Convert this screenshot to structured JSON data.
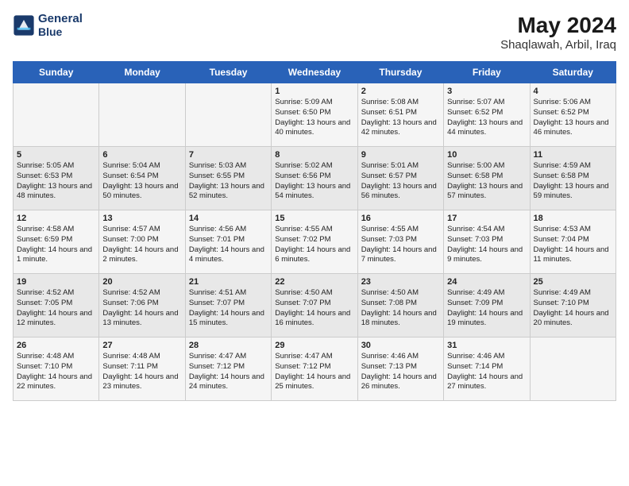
{
  "logo": {
    "line1": "General",
    "line2": "Blue"
  },
  "title": "May 2024",
  "subtitle": "Shaqlawah, Arbil, Iraq",
  "days_of_week": [
    "Sunday",
    "Monday",
    "Tuesday",
    "Wednesday",
    "Thursday",
    "Friday",
    "Saturday"
  ],
  "weeks": [
    [
      {
        "day": "",
        "info": ""
      },
      {
        "day": "",
        "info": ""
      },
      {
        "day": "",
        "info": ""
      },
      {
        "day": "1",
        "info": "Sunrise: 5:09 AM\nSunset: 6:50 PM\nDaylight: 13 hours\nand 40 minutes."
      },
      {
        "day": "2",
        "info": "Sunrise: 5:08 AM\nSunset: 6:51 PM\nDaylight: 13 hours\nand 42 minutes."
      },
      {
        "day": "3",
        "info": "Sunrise: 5:07 AM\nSunset: 6:52 PM\nDaylight: 13 hours\nand 44 minutes."
      },
      {
        "day": "4",
        "info": "Sunrise: 5:06 AM\nSunset: 6:52 PM\nDaylight: 13 hours\nand 46 minutes."
      }
    ],
    [
      {
        "day": "5",
        "info": "Sunrise: 5:05 AM\nSunset: 6:53 PM\nDaylight: 13 hours\nand 48 minutes."
      },
      {
        "day": "6",
        "info": "Sunrise: 5:04 AM\nSunset: 6:54 PM\nDaylight: 13 hours\nand 50 minutes."
      },
      {
        "day": "7",
        "info": "Sunrise: 5:03 AM\nSunset: 6:55 PM\nDaylight: 13 hours\nand 52 minutes."
      },
      {
        "day": "8",
        "info": "Sunrise: 5:02 AM\nSunset: 6:56 PM\nDaylight: 13 hours\nand 54 minutes."
      },
      {
        "day": "9",
        "info": "Sunrise: 5:01 AM\nSunset: 6:57 PM\nDaylight: 13 hours\nand 56 minutes."
      },
      {
        "day": "10",
        "info": "Sunrise: 5:00 AM\nSunset: 6:58 PM\nDaylight: 13 hours\nand 57 minutes."
      },
      {
        "day": "11",
        "info": "Sunrise: 4:59 AM\nSunset: 6:58 PM\nDaylight: 13 hours\nand 59 minutes."
      }
    ],
    [
      {
        "day": "12",
        "info": "Sunrise: 4:58 AM\nSunset: 6:59 PM\nDaylight: 14 hours\nand 1 minute."
      },
      {
        "day": "13",
        "info": "Sunrise: 4:57 AM\nSunset: 7:00 PM\nDaylight: 14 hours\nand 2 minutes."
      },
      {
        "day": "14",
        "info": "Sunrise: 4:56 AM\nSunset: 7:01 PM\nDaylight: 14 hours\nand 4 minutes."
      },
      {
        "day": "15",
        "info": "Sunrise: 4:55 AM\nSunset: 7:02 PM\nDaylight: 14 hours\nand 6 minutes."
      },
      {
        "day": "16",
        "info": "Sunrise: 4:55 AM\nSunset: 7:03 PM\nDaylight: 14 hours\nand 7 minutes."
      },
      {
        "day": "17",
        "info": "Sunrise: 4:54 AM\nSunset: 7:03 PM\nDaylight: 14 hours\nand 9 minutes."
      },
      {
        "day": "18",
        "info": "Sunrise: 4:53 AM\nSunset: 7:04 PM\nDaylight: 14 hours\nand 11 minutes."
      }
    ],
    [
      {
        "day": "19",
        "info": "Sunrise: 4:52 AM\nSunset: 7:05 PM\nDaylight: 14 hours\nand 12 minutes."
      },
      {
        "day": "20",
        "info": "Sunrise: 4:52 AM\nSunset: 7:06 PM\nDaylight: 14 hours\nand 13 minutes."
      },
      {
        "day": "21",
        "info": "Sunrise: 4:51 AM\nSunset: 7:07 PM\nDaylight: 14 hours\nand 15 minutes."
      },
      {
        "day": "22",
        "info": "Sunrise: 4:50 AM\nSunset: 7:07 PM\nDaylight: 14 hours\nand 16 minutes."
      },
      {
        "day": "23",
        "info": "Sunrise: 4:50 AM\nSunset: 7:08 PM\nDaylight: 14 hours\nand 18 minutes."
      },
      {
        "day": "24",
        "info": "Sunrise: 4:49 AM\nSunset: 7:09 PM\nDaylight: 14 hours\nand 19 minutes."
      },
      {
        "day": "25",
        "info": "Sunrise: 4:49 AM\nSunset: 7:10 PM\nDaylight: 14 hours\nand 20 minutes."
      }
    ],
    [
      {
        "day": "26",
        "info": "Sunrise: 4:48 AM\nSunset: 7:10 PM\nDaylight: 14 hours\nand 22 minutes."
      },
      {
        "day": "27",
        "info": "Sunrise: 4:48 AM\nSunset: 7:11 PM\nDaylight: 14 hours\nand 23 minutes."
      },
      {
        "day": "28",
        "info": "Sunrise: 4:47 AM\nSunset: 7:12 PM\nDaylight: 14 hours\nand 24 minutes."
      },
      {
        "day": "29",
        "info": "Sunrise: 4:47 AM\nSunset: 7:12 PM\nDaylight: 14 hours\nand 25 minutes."
      },
      {
        "day": "30",
        "info": "Sunrise: 4:46 AM\nSunset: 7:13 PM\nDaylight: 14 hours\nand 26 minutes."
      },
      {
        "day": "31",
        "info": "Sunrise: 4:46 AM\nSunset: 7:14 PM\nDaylight: 14 hours\nand 27 minutes."
      },
      {
        "day": "",
        "info": ""
      }
    ]
  ]
}
